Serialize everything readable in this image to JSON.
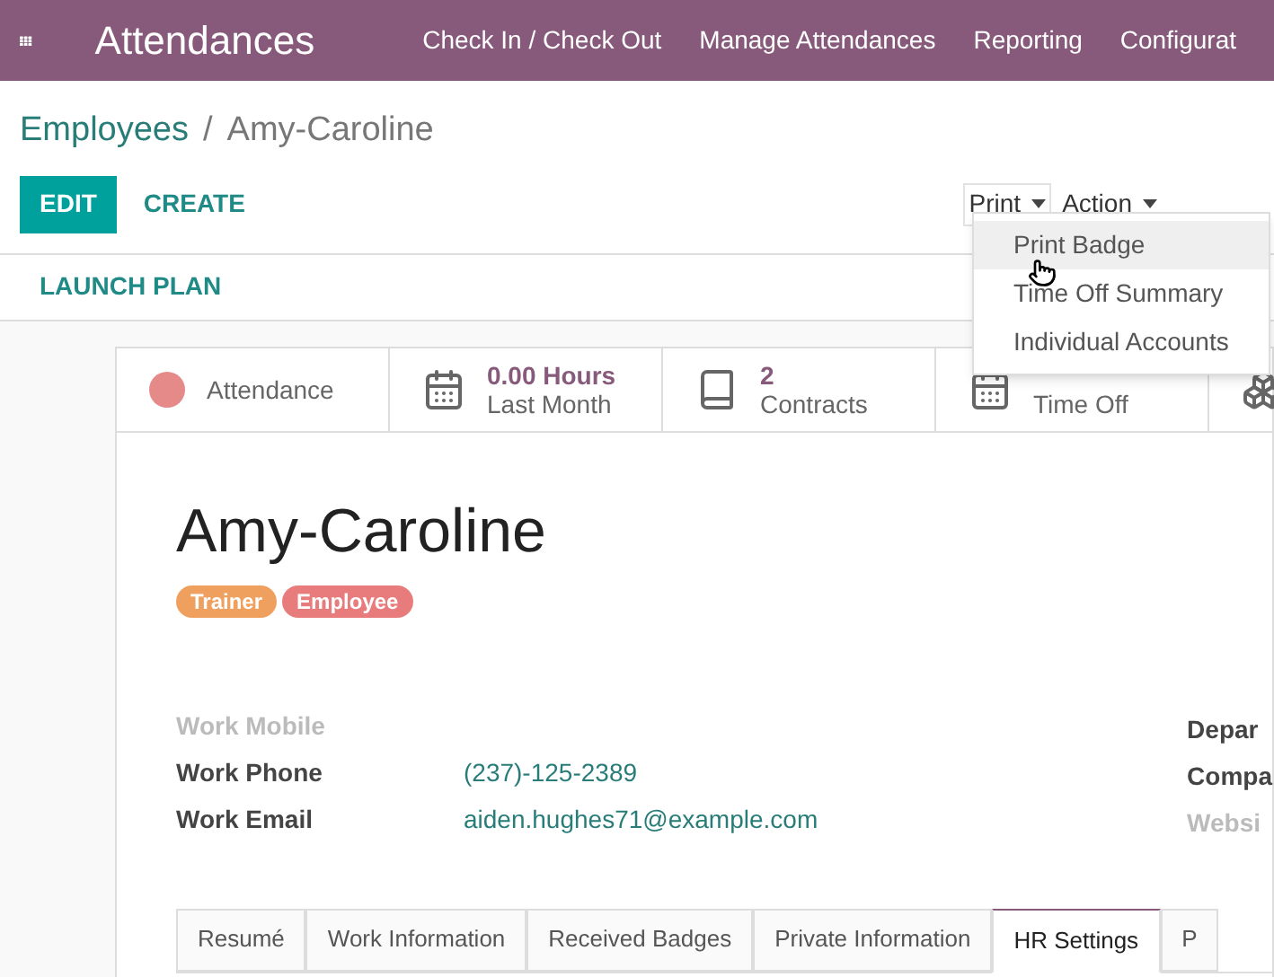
{
  "navbar": {
    "app_title": "Attendances",
    "menu": [
      "Check In / Check Out",
      "Manage Attendances",
      "Reporting",
      "Configurat"
    ]
  },
  "breadcrumb": {
    "parent": "Employees",
    "separator": "/",
    "current": "Amy-Caroline"
  },
  "buttons": {
    "edit": "EDIT",
    "create": "CREATE",
    "launch_plan": "LAUNCH PLAN"
  },
  "dropdowns": [
    {
      "label": "Print",
      "open": true
    },
    {
      "label": "Action",
      "open": false
    }
  ],
  "print_menu": [
    {
      "label": "Print Badge",
      "highlighted": true
    },
    {
      "label": "Time Off Summary",
      "highlighted": false
    },
    {
      "label": "Individual Accounts",
      "highlighted": false
    }
  ],
  "stat_buttons": [
    {
      "kind": "status",
      "label": "Attendance",
      "color": "#e58989"
    },
    {
      "kind": "calendar",
      "value": "0.00 Hours",
      "label": "Last Month"
    },
    {
      "kind": "book",
      "value": "2",
      "label": "Contracts"
    },
    {
      "kind": "calendar",
      "label": "Time Off"
    },
    {
      "kind": "cubes"
    }
  ],
  "employee": {
    "name": "Amy-Caroline",
    "tags": [
      {
        "label": "Trainer",
        "color": "#f0a05e"
      },
      {
        "label": "Employee",
        "color": "#e87c7c"
      }
    ]
  },
  "fields_left": [
    {
      "label": "Work Mobile",
      "empty": true
    },
    {
      "label": "Work Phone",
      "empty": false,
      "value": "(237)-125-2389"
    },
    {
      "label": "Work Email",
      "empty": false,
      "value": "aiden.hughes71@example.com"
    }
  ],
  "fields_right": [
    {
      "label": "Depar",
      "empty": false
    },
    {
      "label": "Compa",
      "empty": false
    },
    {
      "label": "Websi",
      "empty": true
    }
  ],
  "tabs": [
    {
      "label": "Resumé",
      "selected": false
    },
    {
      "label": "Work Information",
      "selected": false
    },
    {
      "label": "Received Badges",
      "selected": false
    },
    {
      "label": "Private Information",
      "selected": false
    },
    {
      "label": "HR Settings",
      "selected": true
    },
    {
      "label": "P",
      "selected": false
    }
  ]
}
